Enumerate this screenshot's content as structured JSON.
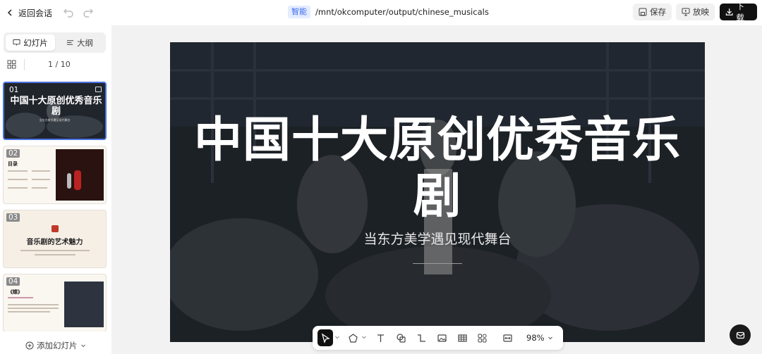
{
  "topbar": {
    "back_label": "返回会话",
    "tag": "智能",
    "path": "/mnt/okcomputer/output/chinese_musicals",
    "save_label": "保存",
    "present_label": "放映",
    "download_label": "下载"
  },
  "sidebar": {
    "tabs": [
      {
        "label": "幻灯片",
        "active": true
      },
      {
        "label": "大纲",
        "active": false
      }
    ],
    "pager": "1 / 10",
    "add_slide_label": "添加幻灯片",
    "thumbnails": [
      {
        "number": "01",
        "title": "中国十大原创优秀音乐剧",
        "subtitle": "当东方美学遇见现代舞台",
        "selected": true
      },
      {
        "number": "02",
        "title": "目录",
        "selected": false
      },
      {
        "number": "03",
        "title": "音乐剧的艺术魅力",
        "selected": false
      },
      {
        "number": "04",
        "title": "《蝶》",
        "selected": false
      }
    ]
  },
  "slide": {
    "title": "中国十大原创优秀音乐剧",
    "subtitle": "当东方美学遇见现代舞台"
  },
  "toolbar": {
    "tools": [
      "select-icon",
      "shape-icon",
      "text-icon",
      "copy-icon",
      "connector-icon",
      "image-icon",
      "table-icon",
      "components-icon",
      "fit-icon"
    ],
    "zoom": "98%"
  },
  "colors": {
    "accent": "#4b73e6",
    "download_bg": "#111111",
    "tag_bg": "#e4ecff",
    "tag_text": "#3b6cf0"
  }
}
